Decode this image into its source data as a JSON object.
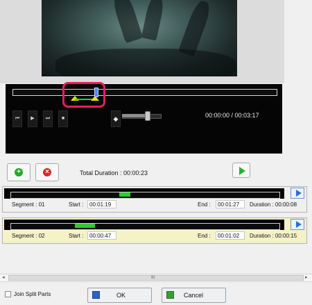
{
  "player": {
    "time_display": "00:00:00 / 00:03:17",
    "transport_buttons": [
      {
        "name": "previous",
        "glyph": "⏮"
      },
      {
        "name": "play",
        "glyph": "▶"
      },
      {
        "name": "next",
        "glyph": "⏭"
      },
      {
        "name": "stop",
        "glyph": "■"
      }
    ],
    "volume_glyph": "◆"
  },
  "toolbar": {
    "total_duration": "Total Duration : 00:00:23",
    "add_glyph": "+",
    "remove_glyph": "×"
  },
  "segments": [
    {
      "label": "Segment : 01",
      "start_label": "Start :",
      "start": "00:01:19",
      "end_label": "End :",
      "end": "00:01:27",
      "duration": "Duration : 00:00:08",
      "background": "#f0f0f0"
    },
    {
      "label": "Segment : 02",
      "start_label": "Start :",
      "start": "00:00:47",
      "end_label": "End :",
      "end": "00:01:02",
      "duration": "Duration : 00:00:15",
      "background": "#f6f2c8"
    }
  ],
  "scrollbar": {
    "left_arrow": "◂",
    "grip": "III",
    "right_arrow": "▸"
  },
  "footer": {
    "join_label": "Join Split Parts",
    "ok_label": "OK",
    "cancel_label": "Cancel"
  },
  "colors": {
    "highlight": "#e0215d",
    "playhead": "#4a90e2",
    "segment_fill": "#2ecb2e",
    "marker": "#e6e600"
  }
}
